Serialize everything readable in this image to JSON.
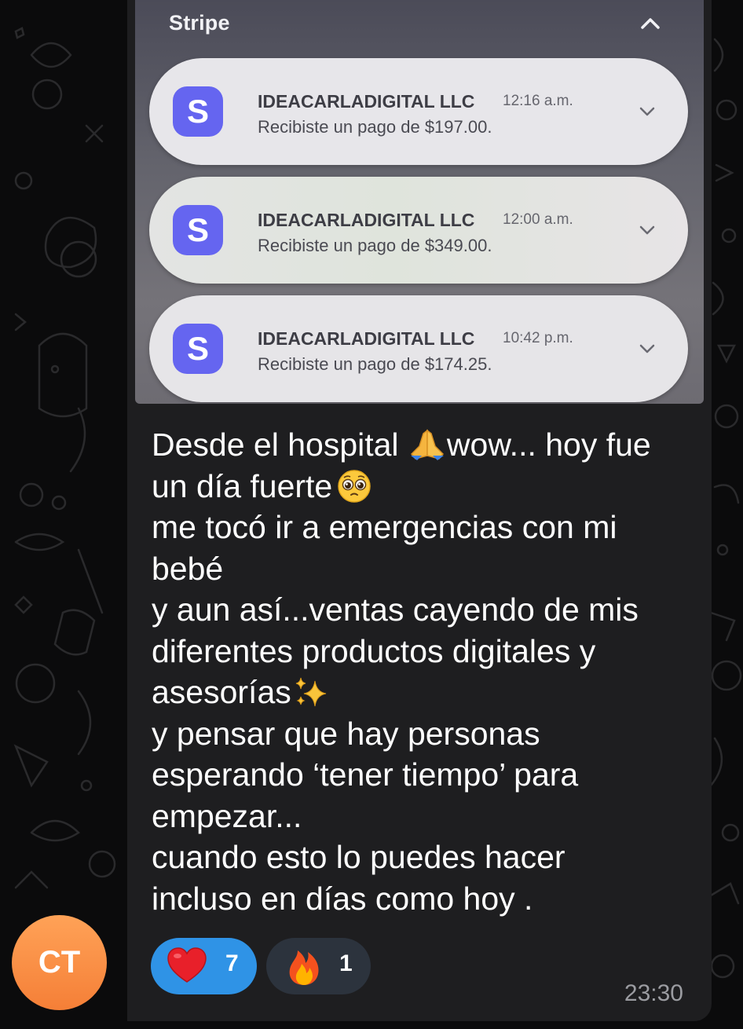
{
  "screenshot": {
    "app_name": "Stripe",
    "notifications": [
      {
        "icon_letter": "S",
        "sender": "IDEACARLADIGITAL LLC",
        "time": "12:16 a.m.",
        "message": "Recibiste un pago de $197.00."
      },
      {
        "icon_letter": "S",
        "sender": "IDEACARLADIGITAL LLC",
        "time": "12:00 a.m.",
        "message": "Recibiste un pago de $349.00."
      },
      {
        "icon_letter": "S",
        "sender": "IDEACARLADIGITAL LLC",
        "time": "10:42 p.m.",
        "message": "Recibiste un pago de $174.25."
      }
    ]
  },
  "message": {
    "lines": [
      {
        "before": "Desde el hospital ",
        "emoji": "folded-hands",
        "after": "wow... hoy fue"
      },
      {
        "before": "un día fuerte",
        "emoji": "pleading-face",
        "after": ""
      },
      {
        "before": "me tocó ir a emergencias con mi",
        "emoji": "",
        "after": ""
      },
      {
        "before": "bebé",
        "emoji": "",
        "after": ""
      },
      {
        "before": "y aun así...ventas cayendo de mis",
        "emoji": "",
        "after": ""
      },
      {
        "before": "diferentes productos digitales y",
        "emoji": "",
        "after": ""
      },
      {
        "before": "asesorías",
        "emoji": "sparkles",
        "after": ""
      },
      {
        "before": "y pensar que hay personas",
        "emoji": "",
        "after": ""
      },
      {
        "before": "esperando ‘tener tiempo’ para",
        "emoji": "",
        "after": ""
      },
      {
        "before": "empezar...",
        "emoji": "",
        "after": ""
      },
      {
        "before": "cuando esto lo puedes hacer",
        "emoji": "",
        "after": ""
      },
      {
        "before": "incluso en días como hoy .",
        "emoji": "",
        "after": ""
      }
    ],
    "timestamp": "23:30"
  },
  "reactions": [
    {
      "icon": "red-heart-icon",
      "count": "7"
    },
    {
      "icon": "fire-icon",
      "count": "1"
    }
  ],
  "sender_avatar": {
    "initials": "CT"
  },
  "colors": {
    "background": "#0b0b0c",
    "bubble": "#1e1e20",
    "reaction_selected": "#2f93e6",
    "reaction_default": "#2c333d",
    "stripe_icon": "#6565f0",
    "avatar": "#f88f44"
  }
}
